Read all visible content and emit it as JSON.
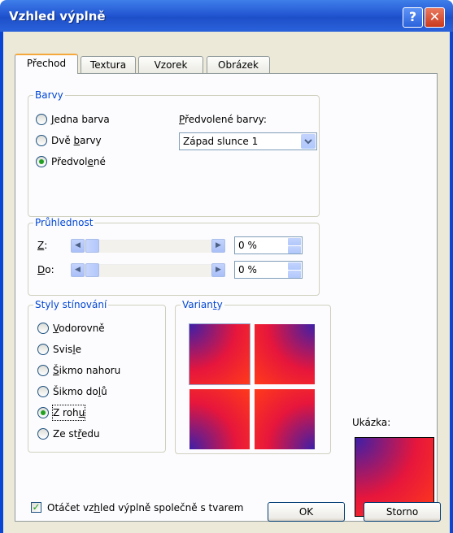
{
  "window": {
    "title": "Vzhled výplně",
    "help_glyph": "?",
    "close_glyph": "✕"
  },
  "tabs": [
    {
      "label": "Přechod",
      "active": true
    },
    {
      "label": "Textura",
      "active": false
    },
    {
      "label": "Vzorek",
      "active": false
    },
    {
      "label": "Obrázek",
      "active": false
    }
  ],
  "colors": {
    "group_label": "Barvy",
    "options": [
      {
        "pre": "",
        "key": "J",
        "post": "edna barva",
        "checked": false
      },
      {
        "pre": "Dvě ",
        "key": "b",
        "post": "arvy",
        "checked": false
      },
      {
        "pre": "Předvol",
        "key": "e",
        "post": "né",
        "checked": true
      }
    ],
    "preset_label_key": "P",
    "preset_label_rest": "ředvolené barvy:",
    "preset_value": "Západ slunce 1"
  },
  "transparency": {
    "group_label": "Průhlednost",
    "from_key": "Z",
    "from_rest": ":",
    "from_value": "0 %",
    "to_key": "D",
    "to_rest": "o:",
    "to_value": "0 %"
  },
  "shading": {
    "group_label": "Styly stínování",
    "options": [
      {
        "pre": "",
        "key": "V",
        "post": "odorovně",
        "checked": false
      },
      {
        "pre": "Svis",
        "key": "l",
        "post": "e",
        "checked": false
      },
      {
        "pre": "",
        "key": "Š",
        "post": "ikmo nahoru",
        "checked": false
      },
      {
        "pre": "Šikmo do",
        "key": "l",
        "post": "ů",
        "checked": false
      },
      {
        "pre": "Z roh",
        "key": "u",
        "post": "",
        "checked": true
      },
      {
        "pre": "Ze st",
        "key": "ř",
        "post": "edu",
        "checked": false
      }
    ]
  },
  "variants": {
    "group_label_pre": "Varian",
    "group_label_key": "t",
    "group_label_post": "y"
  },
  "preview": {
    "label": "Ukázka:"
  },
  "rotate_option": {
    "pre": "Otáčet vz",
    "key": "h",
    "post": "led výplně společně s tvarem",
    "checked": true
  },
  "buttons": {
    "ok": "OK",
    "cancel": "Storno"
  },
  "gradient_colors": {
    "dark": "#3d1fa8",
    "mid": "#e6163c",
    "light": "#ff3a1a"
  }
}
